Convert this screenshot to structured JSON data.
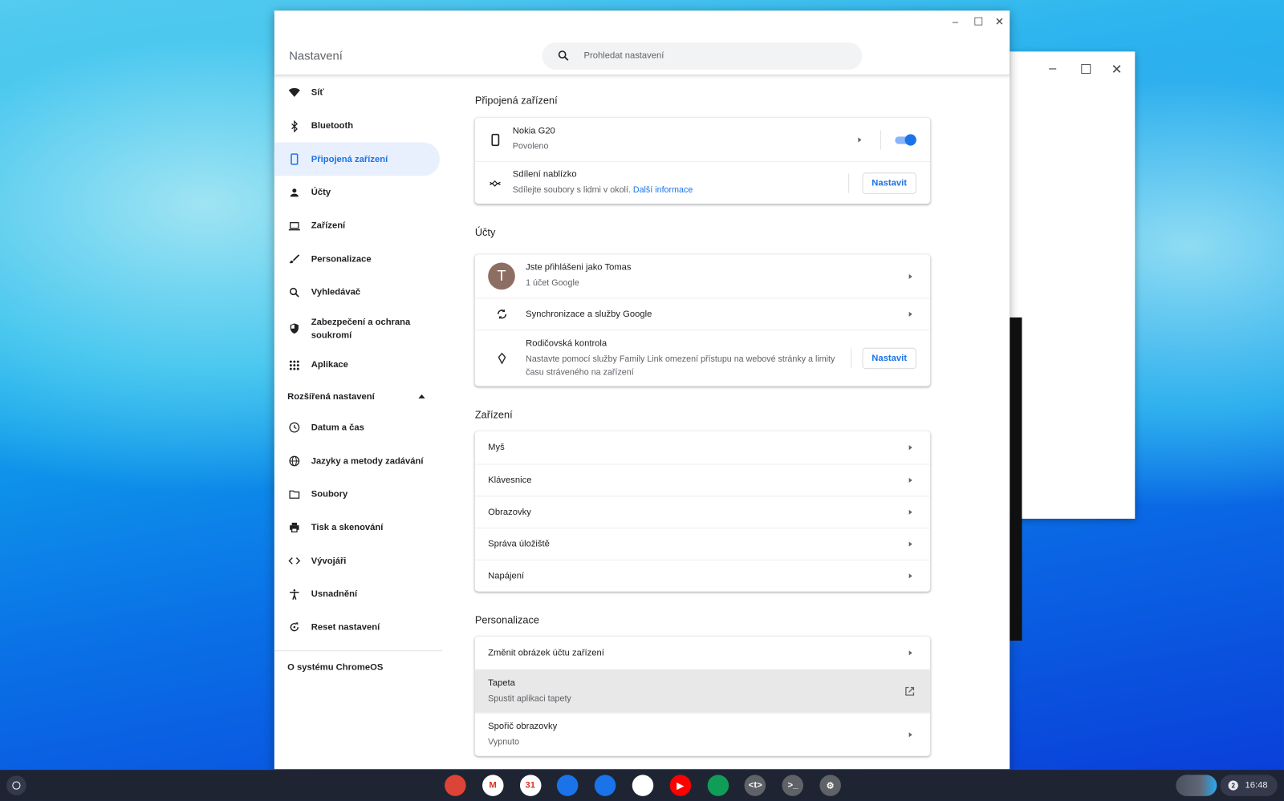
{
  "window": {
    "title": "Nastavení",
    "search_placeholder": "Prohledat nastavení",
    "minimize": "–",
    "maximize": "☐",
    "close": "✕"
  },
  "sidebar": {
    "items": [
      {
        "label": "Síť",
        "icon": "wifi-icon"
      },
      {
        "label": "Bluetooth",
        "icon": "bluetooth-icon"
      },
      {
        "label": "Připojená zařízení",
        "icon": "phone-icon",
        "active": true
      },
      {
        "label": "Účty",
        "icon": "person-icon"
      },
      {
        "label": "Zařízení",
        "icon": "laptop-icon"
      },
      {
        "label": "Personalizace",
        "icon": "brush-icon"
      },
      {
        "label": "Vyhledávač",
        "icon": "search-icon"
      },
      {
        "label": "Zabezpečení a ochrana soukromí",
        "icon": "shield-icon"
      },
      {
        "label": "Aplikace",
        "icon": "apps-grid-icon"
      }
    ],
    "advanced": "Rozšířená nastavení",
    "advanced_items": [
      {
        "label": "Datum a čas",
        "icon": "clock-icon"
      },
      {
        "label": "Jazyky a metody zadávání",
        "icon": "globe-icon"
      },
      {
        "label": "Soubory",
        "icon": "folder-icon"
      },
      {
        "label": "Tisk a skenování",
        "icon": "printer-icon"
      },
      {
        "label": "Vývojáři",
        "icon": "code-icon"
      },
      {
        "label": "Usnadnění",
        "icon": "accessibility-icon"
      },
      {
        "label": "Reset nastavení",
        "icon": "reset-icon"
      }
    ],
    "about": "O systému ChromeOS"
  },
  "sections": {
    "connected": {
      "title": "Připojená zařízení",
      "phone_name": "Nokia G20",
      "phone_status": "Povoleno",
      "phone_enabled": true,
      "nearby_title": "Sdílení nablízko",
      "nearby_desc": "Sdílejte soubory s lidmi v okolí.",
      "nearby_link": "Další informace",
      "nearby_button": "Nastavit"
    },
    "accounts": {
      "title": "Účty",
      "avatar_letter": "T",
      "signed_in": "Jste přihlášeni jako Tomas",
      "account_count": "1 účet Google",
      "sync": "Synchronizace a služby Google",
      "parental_title": "Rodičovská kontrola",
      "parental_desc": "Nastavte pomocí služby Family Link omezení přístupu na webové stránky a limity času stráveného na zařízení",
      "parental_button": "Nastavit"
    },
    "device": {
      "title": "Zařízení",
      "items": [
        "Myš",
        "Klávesnice",
        "Obrazovky",
        "Správa úložiště",
        "Napájení"
      ]
    },
    "personalization": {
      "title": "Personalizace",
      "change_picture": "Změnit obrázek účtu zařízení",
      "wallpaper": "Tapeta",
      "wallpaper_desc": "Spustit aplikaci tapety",
      "screensaver": "Spořič obrazovky",
      "screensaver_desc": "Vypnuto"
    }
  },
  "taskbar": {
    "apps": [
      {
        "name": "chrome",
        "color": "#db4437",
        "label": ""
      },
      {
        "name": "gmail",
        "color": "#ffffff",
        "label": "M"
      },
      {
        "name": "calendar",
        "color": "#ffffff",
        "label": "31"
      },
      {
        "name": "files",
        "color": "#1a73e8",
        "label": ""
      },
      {
        "name": "messages",
        "color": "#1a73e8",
        "label": ""
      },
      {
        "name": "meet",
        "color": "#ffffff",
        "label": ""
      },
      {
        "name": "youtube",
        "color": "#ff0000",
        "label": "▶"
      },
      {
        "name": "app-green",
        "color": "#0f9d58",
        "label": ""
      },
      {
        "name": "crostini-text",
        "color": "#5f6368",
        "label": "<t>"
      },
      {
        "name": "terminal",
        "color": "#5f6368",
        "label": ">_"
      },
      {
        "name": "settings",
        "color": "#5f6368",
        "label": "⚙"
      }
    ],
    "notification_count": "2",
    "time": "16:48"
  },
  "colors": {
    "accent": "#1a73e8",
    "active_bg": "#e8f0fe",
    "taskbar": "#1f2433"
  }
}
